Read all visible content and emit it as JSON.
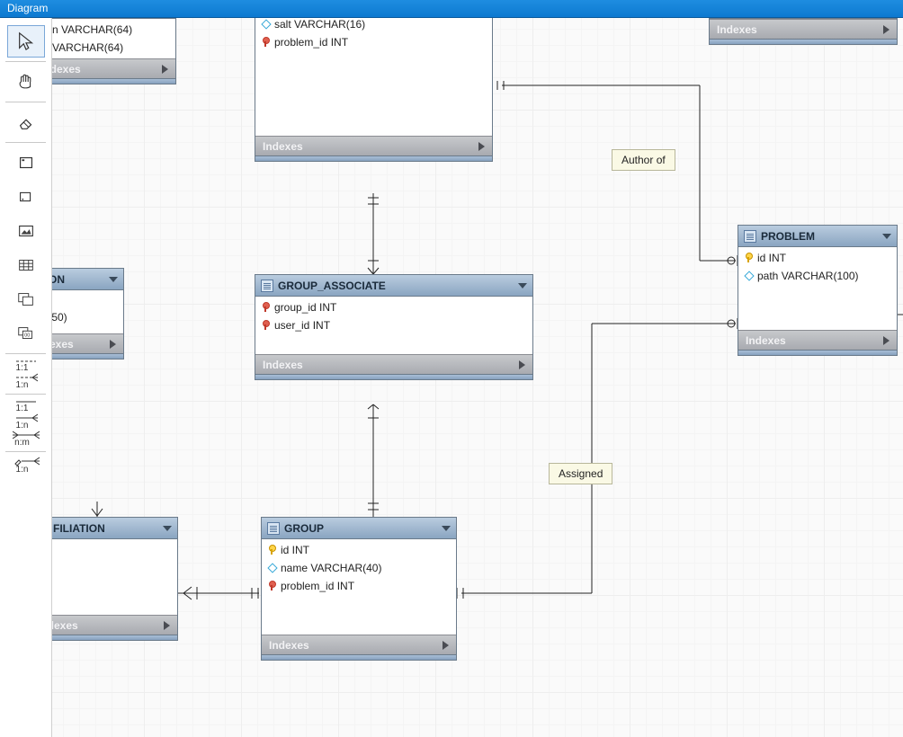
{
  "header": {
    "title": "Diagram"
  },
  "toolbar": {
    "items": [
      "cursor",
      "hand",
      "eraser",
      "rect",
      "note",
      "image",
      "table",
      "layers",
      "stamp"
    ],
    "relations": [
      {
        "style": "dashed",
        "label": "1:1"
      },
      {
        "style": "crow",
        "label": "1:n"
      },
      {
        "style": "solid",
        "label": "1:1"
      },
      {
        "style": "crow2",
        "label": "1:n"
      },
      {
        "style": "nm",
        "label": "n:m"
      },
      {
        "style": "pencil",
        "label": "1:n"
      }
    ]
  },
  "relations": {
    "author_of": "Author of",
    "assigned": "Assigned"
  },
  "tables": {
    "user": {
      "title": "",
      "indexes_label": "Indexes",
      "columns": [
        {
          "icon": "",
          "text": "n VARCHAR(64)"
        },
        {
          "icon": "",
          "text": "VARCHAR(64)"
        }
      ]
    },
    "usercred": {
      "indexes_label": "Indexes",
      "columns": [
        {
          "icon": "at",
          "text": "salt VARCHAR(16)"
        },
        {
          "icon": "fk",
          "text": "problem_id INT"
        }
      ]
    },
    "on": {
      "title": "ON",
      "indexes_label": "Indexes",
      "columns": [
        {
          "icon": "",
          "text": ".(50)"
        }
      ]
    },
    "filiation": {
      "title": "FILIATION",
      "indexes_label": "Indexes"
    },
    "group_assoc": {
      "title": "GROUP_ASSOCIATE",
      "indexes_label": "Indexes",
      "columns": [
        {
          "icon": "fk",
          "text": "group_id INT"
        },
        {
          "icon": "fk",
          "text": "user_id INT"
        }
      ]
    },
    "group": {
      "title": "GROUP",
      "indexes_label": "Indexes",
      "columns": [
        {
          "icon": "pk",
          "text": "id INT"
        },
        {
          "icon": "at",
          "text": "name VARCHAR(40)"
        },
        {
          "icon": "fk",
          "text": "problem_id INT"
        }
      ]
    },
    "problem": {
      "title": "PROBLEM",
      "indexes_label": "Indexes",
      "columns": [
        {
          "icon": "pk",
          "text": "id INT"
        },
        {
          "icon": "at",
          "text": "path VARCHAR(100)"
        }
      ]
    },
    "topidx": {
      "indexes_label": "Indexes"
    }
  }
}
